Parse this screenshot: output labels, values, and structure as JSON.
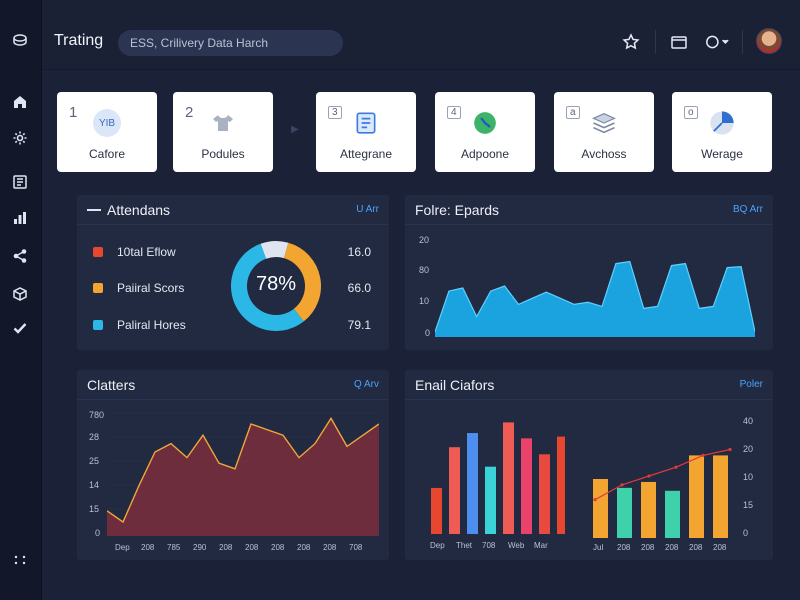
{
  "header": {
    "title": "Trating",
    "search_placeholder": "ESS, Crilivery Data Harch"
  },
  "sidebar": {
    "icons": [
      "logo-icon",
      "home-icon",
      "settings-icon",
      "document-icon",
      "bar-chart-icon",
      "share-icon",
      "package-icon",
      "check-icon",
      "more-icon"
    ]
  },
  "tiles": [
    {
      "num": "1",
      "label": "Cafore",
      "badge": "YIB"
    },
    {
      "num": "2",
      "label": "Podules"
    },
    {
      "num": "3",
      "label": "Attegrane"
    },
    {
      "num": "4",
      "label": "Adpoone"
    },
    {
      "num": "a",
      "label": "Avchoss"
    },
    {
      "num": "o",
      "label": "Werage"
    }
  ],
  "attendance": {
    "title": "Attendans",
    "link": "U Arr",
    "percent_label": "78%",
    "items": [
      {
        "label": "10tal Eflow",
        "value": "16.0",
        "color": "#e8472f"
      },
      {
        "label": "Paiiral Scors",
        "value": "66.0",
        "color": "#f2a531"
      },
      {
        "label": "Paliral Hores",
        "value": "79.1",
        "color": "#2cb8e6"
      }
    ]
  },
  "epards": {
    "title": "Folre: Epards",
    "link": "BQ Arr",
    "yticks": [
      "20",
      "80",
      "10",
      "0"
    ]
  },
  "clatters": {
    "title": "Clatters",
    "link": "Q Arv",
    "yticks": [
      "780",
      "28",
      "25",
      "14",
      "15",
      "0"
    ],
    "xticks": [
      "Dep",
      "208",
      "785",
      "290",
      "208",
      "208",
      "208",
      "208",
      "208",
      "708"
    ]
  },
  "email": {
    "title": "Enail Ciafors",
    "link": "Poler",
    "left_xticks": [
      "Dep",
      "Thet",
      "708",
      "Web",
      "Mar"
    ],
    "right_xticks": [
      "Jul",
      "208",
      "208",
      "208",
      "208",
      "208"
    ],
    "right_yticks": [
      "40",
      "20",
      "10",
      "15",
      "0"
    ]
  },
  "chart_data": [
    {
      "type": "pie",
      "title": "Attendans",
      "labels": [
        "10tal Eflow",
        "Paiiral Scors",
        "Paliral Hores"
      ],
      "values": [
        10,
        35,
        55
      ],
      "center_label": "78%"
    },
    {
      "type": "area",
      "title": "Folre: Epards",
      "y": [
        5,
        45,
        48,
        20,
        45,
        50,
        32,
        38,
        44,
        38,
        32,
        34,
        30,
        72,
        74,
        28,
        30,
        70,
        72,
        28,
        30,
        68,
        69,
        5
      ],
      "ylim": [
        0,
        100
      ],
      "yticks": [
        "20",
        "80",
        "10",
        "0"
      ]
    },
    {
      "type": "area",
      "title": "Clatters",
      "y": [
        9,
        5,
        18,
        30,
        33,
        28,
        36,
        26,
        24,
        40,
        38,
        36,
        28,
        33,
        42,
        32,
        36,
        40
      ],
      "ylim": [
        0,
        45
      ],
      "xticks": [
        "Dep",
        "208",
        "785",
        "290",
        "208",
        "208",
        "208",
        "208",
        "208",
        "708"
      ]
    },
    {
      "type": "bar",
      "title": "Enail Ciafors",
      "categories": [
        "Dep",
        "Thet",
        "708",
        "Web",
        "Mar"
      ],
      "values": [
        26,
        49,
        57,
        38,
        63,
        54,
        45,
        55
      ],
      "colors": [
        "#e8472f",
        "#ef5c56",
        "#4d8ff0",
        "#3ad3d8",
        "#ef5c56",
        "#e9426b",
        "#e84a3f",
        "#e8472f"
      ]
    },
    {
      "type": "bar",
      "title": "Enail Ciafors",
      "categories": [
        "Jul",
        "208",
        "208",
        "208",
        "208",
        "208"
      ],
      "values": [
        20,
        17,
        19,
        16,
        28,
        28
      ],
      "line": [
        13,
        18,
        21,
        24,
        28,
        30
      ],
      "ylim": [
        0,
        40
      ],
      "colors": [
        "#f2a531",
        "#3fd1a9",
        "#f2a531",
        "#3fd1a9",
        "#f2a531",
        "#f2a531"
      ]
    }
  ]
}
